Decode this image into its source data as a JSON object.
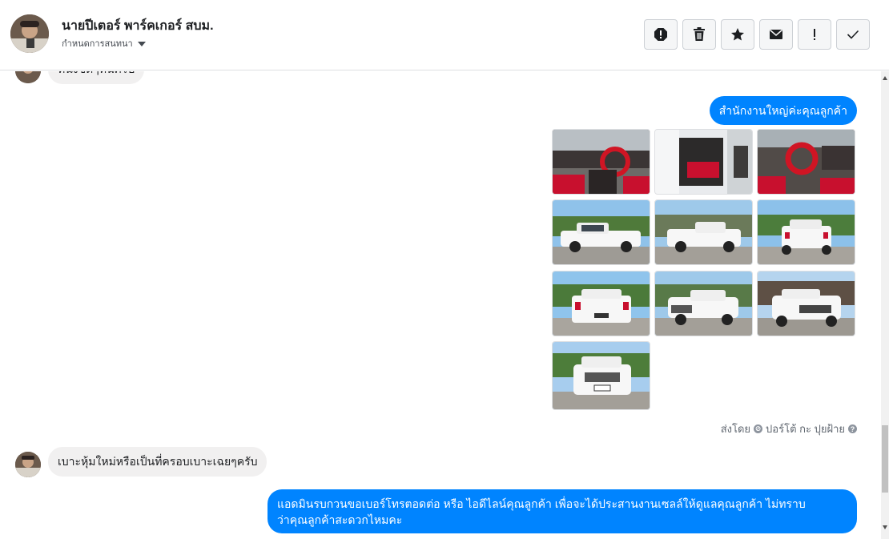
{
  "header": {
    "name": "นายปีเตอร์ พาร์คเกอร์ สบม.",
    "assign_label": "กำหนดการสนทนา"
  },
  "toolbar": {
    "buttons": [
      {
        "icon": "spam-alert-icon"
      },
      {
        "icon": "trash-icon"
      },
      {
        "icon": "star-icon"
      },
      {
        "icon": "envelope-icon"
      },
      {
        "icon": "exclamation-icon"
      },
      {
        "icon": "checkmark-icon"
      }
    ]
  },
  "messages": {
    "m1": {
      "from": "customer",
      "text": "ที่นั่งชิดๆที่นครับ"
    },
    "m2": {
      "from": "page",
      "text": "สำนักงานใหญ่ค่ะคุณลูกค้า"
    },
    "photos": {
      "count": 10,
      "descriptions": [
        "interior-dashboard-red-seats",
        "interior-rear-seat",
        "interior-steering-wheel",
        "white-pickup-side",
        "white-pickup-rear-three-quarter",
        "white-pickup-rear-angle",
        "white-pickup-rear",
        "white-pickup-front-three-quarter",
        "white-pickup-front-angle",
        "white-pickup-front"
      ]
    },
    "sent_by": {
      "prefix": "ส่งโดย",
      "sender": "ปอร์โต้ กะ ปุยฝ้าย"
    },
    "m3": {
      "from": "customer",
      "text": "เบาะหุ้มใหม่หรือเป็นที่ครอบเบาะเฉยๆครับ"
    },
    "m4": {
      "from": "page",
      "line1": "แอดมินรบกวนขอเบอร์โทรตอดต่อ หรือ ไอดีไลน์คุณลูกค้า เพื่อจะได้ประสานงานเซลล์ให้ดูแลคุณลูกค้า ไม่ทราบ",
      "line2": "ว่าคุณลูกค้าสะดวกไหมคะ"
    }
  },
  "colors": {
    "outgoing_bubble": "#0084ff",
    "incoming_bubble": "#f1f0f0"
  }
}
